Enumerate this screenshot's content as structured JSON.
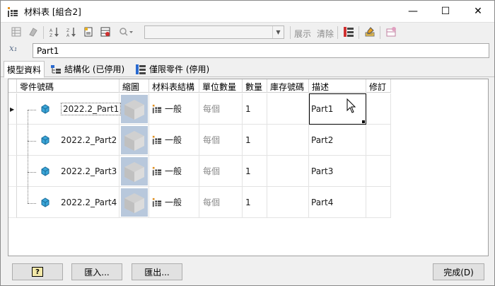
{
  "window": {
    "title": "材料表 [組合2]",
    "controls": {
      "minimize": "—",
      "maximize": "☐",
      "close": "✕"
    }
  },
  "toolbar": {
    "combo_value": "",
    "show_label": "展示",
    "clear_label": "清除"
  },
  "formula": {
    "icon_text": "x₁",
    "value": "Part1"
  },
  "tabs": [
    {
      "label": "模型資料",
      "active": true
    },
    {
      "label": "結構化 (已停用)",
      "active": false
    },
    {
      "label": "僅限零件 (停用)",
      "active": false
    }
  ],
  "grid": {
    "columns": [
      "零件號碼",
      "縮圖",
      "材料表結構",
      "單位數量",
      "數量",
      "庫存號碼",
      "描述",
      "修訂"
    ],
    "rows": [
      {
        "part_number": "2022.2_Part1",
        "bom_structure": "一般",
        "unit_qty": "每個",
        "qty": "1",
        "stock_number": "",
        "description": "Part1",
        "revision": ""
      },
      {
        "part_number": "2022.2_Part2",
        "bom_structure": "一般",
        "unit_qty": "每個",
        "qty": "1",
        "stock_number": "",
        "description": "Part2",
        "revision": ""
      },
      {
        "part_number": "2022.2_Part3",
        "bom_structure": "一般",
        "unit_qty": "每個",
        "qty": "1",
        "stock_number": "",
        "description": "Part3",
        "revision": ""
      },
      {
        "part_number": "2022.2_Part4",
        "bom_structure": "一般",
        "unit_qty": "每個",
        "qty": "1",
        "stock_number": "",
        "description": "Part4",
        "revision": ""
      }
    ]
  },
  "buttons": {
    "help_label": "?",
    "import_label": "匯入...",
    "export_label": "匯出...",
    "done_label": "完成(D)"
  },
  "colors": {
    "part_icon": "#3aa6d8",
    "thumb_bg": "#b8c8dc"
  }
}
